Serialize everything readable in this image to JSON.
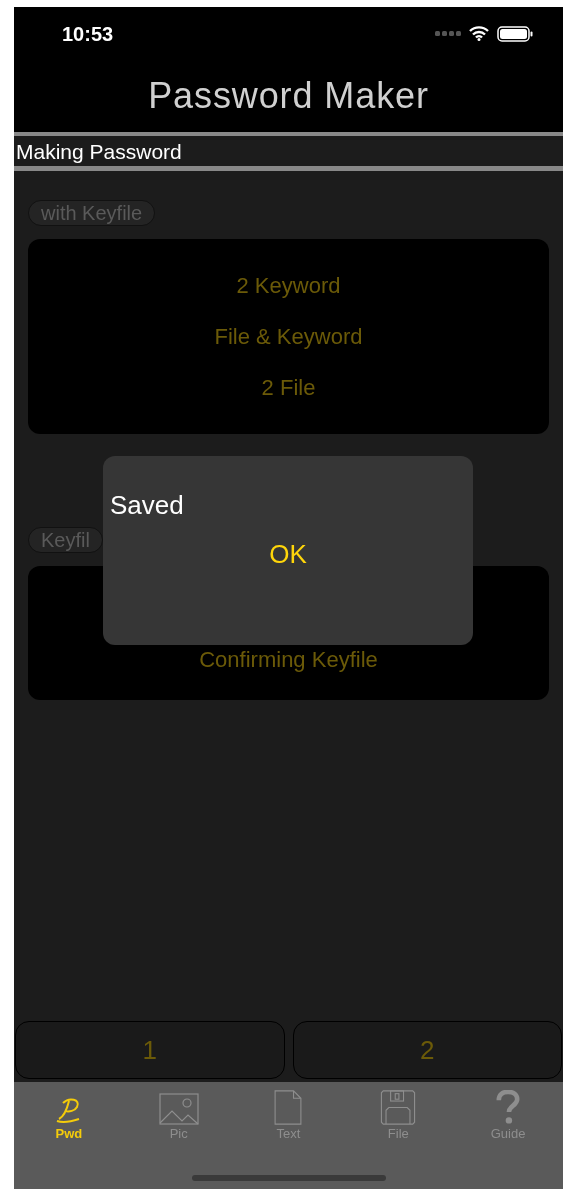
{
  "status_bar": {
    "time": "10:53"
  },
  "title": "Password Maker",
  "section_header": "Making Password",
  "groups": [
    {
      "label": "with Keyfile",
      "items": [
        "2 Keyword",
        "File & Keyword",
        "2 File"
      ]
    },
    {
      "label": "Keyfil",
      "items": [
        "Confirming Keyfile"
      ]
    }
  ],
  "alert": {
    "message": "Saved",
    "button": "OK"
  },
  "bottom_buttons": [
    "1",
    "2"
  ],
  "tabs": [
    {
      "label": "Pwd",
      "kind": "pwd",
      "selected": true
    },
    {
      "label": "Pic",
      "kind": "pic",
      "selected": false
    },
    {
      "label": "Text",
      "kind": "text",
      "selected": false
    },
    {
      "label": "File",
      "kind": "file",
      "selected": false
    },
    {
      "label": "Guide",
      "kind": "guide",
      "selected": false
    }
  ]
}
